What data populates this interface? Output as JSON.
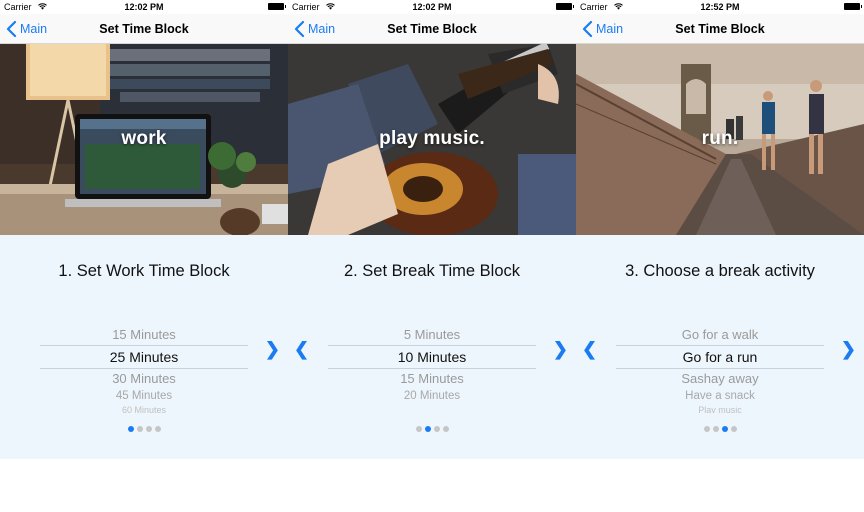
{
  "screens": [
    {
      "status": {
        "carrier": "Carrier",
        "time": "12:02 PM"
      },
      "nav": {
        "back": "Main",
        "title": "Set Time Block"
      },
      "hero_word": "work",
      "step_title": "1. Set Work Time Block",
      "picker": [
        "15 Minutes",
        "25 Minutes",
        "30 Minutes",
        "45 Minutes",
        "60 Minutes"
      ],
      "picker_selected_index": 1,
      "page_dots": 4,
      "page_active": 0,
      "arrows": {
        "left": "",
        "right": "❯"
      }
    },
    {
      "status": {
        "carrier": "Carrier",
        "time": "12:02 PM"
      },
      "nav": {
        "back": "Main",
        "title": "Set Time Block"
      },
      "hero_word": "play music.",
      "step_title": "2. Set Break Time Block",
      "picker": [
        "5 Minutes",
        "10 Minutes",
        "15 Minutes",
        "20 Minutes"
      ],
      "picker_selected_index": 1,
      "page_dots": 4,
      "page_active": 1,
      "arrows": {
        "left": "❮",
        "right": "❯"
      }
    },
    {
      "status": {
        "carrier": "Carrier",
        "time": "12:52 PM"
      },
      "nav": {
        "back": "Main",
        "title": "Set Time Block"
      },
      "hero_word": "run.",
      "step_title": "3. Choose a break activity",
      "picker": [
        "Go for a walk",
        "Go for a run",
        "Sashay away",
        "Have a snack",
        "Play music"
      ],
      "picker_selected_index": 1,
      "page_dots": 4,
      "page_active": 2,
      "arrows": {
        "left": "❮",
        "right": "❯"
      }
    }
  ],
  "colors": {
    "accent": "#1b7cf2",
    "panel_bg": "#eef6fd",
    "dot_inactive": "#c6c6c6"
  }
}
